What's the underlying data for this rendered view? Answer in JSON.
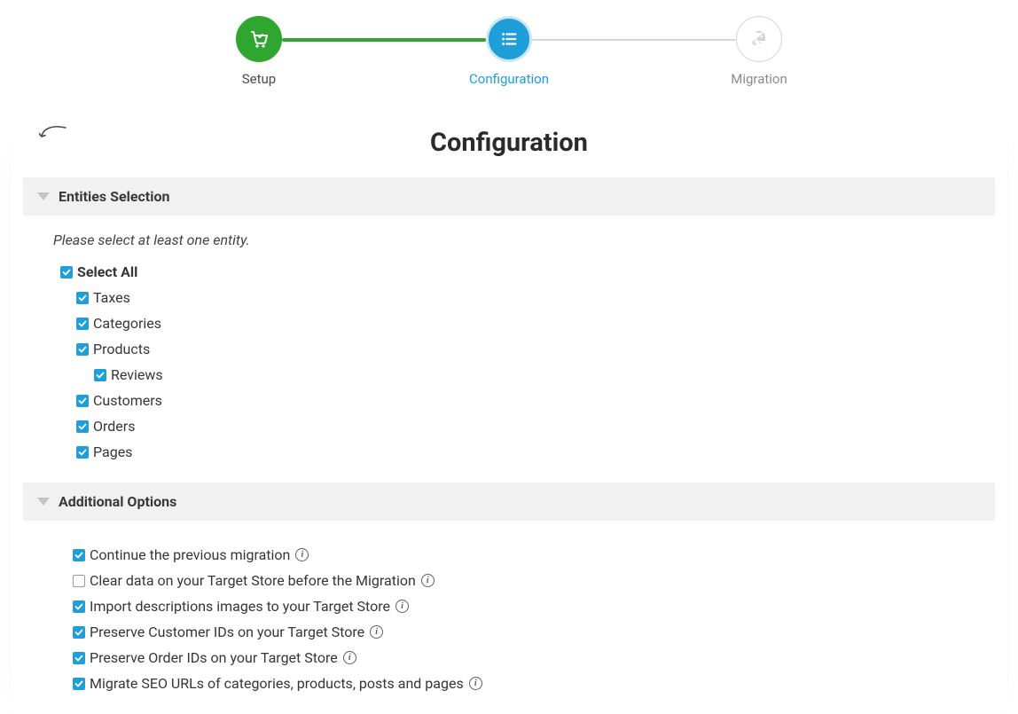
{
  "stepper": {
    "steps": [
      {
        "label": "Setup"
      },
      {
        "label": "Configuration"
      },
      {
        "label": "Migration"
      }
    ]
  },
  "page": {
    "title": "Configuration"
  },
  "sections": {
    "entities": {
      "title": "Entities Selection",
      "instruction": "Please select at least one entity.",
      "select_all_label": "Select All",
      "items": [
        {
          "label": "Taxes"
        },
        {
          "label": "Categories"
        },
        {
          "label": "Products"
        },
        {
          "label": "Reviews"
        },
        {
          "label": "Customers"
        },
        {
          "label": "Orders"
        },
        {
          "label": "Pages"
        }
      ]
    },
    "options": {
      "title": "Additional Options",
      "items": [
        {
          "label": "Continue the previous migration",
          "checked": true
        },
        {
          "label": "Clear data on your Target Store before the Migration",
          "checked": false
        },
        {
          "label": "Import descriptions images to your Target Store",
          "checked": true
        },
        {
          "label": "Preserve Customer IDs on your Target Store",
          "checked": true
        },
        {
          "label": "Preserve Order IDs on your Target Store",
          "checked": true
        },
        {
          "label": "Migrate SEO URLs of categories, products, posts and pages",
          "checked": true
        }
      ]
    }
  }
}
